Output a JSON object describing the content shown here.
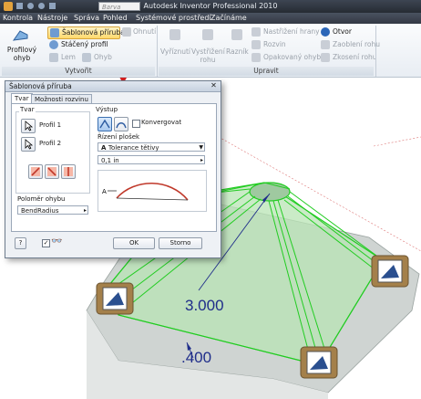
{
  "titlebar": {
    "app_title": "Autodesk Inventor Professional 2010",
    "search_placeholder": "Barva"
  },
  "menu": [
    {
      "label": "Kontrola"
    },
    {
      "label": "Nástroje"
    },
    {
      "label": "Správa"
    },
    {
      "label": "Pohled"
    },
    {
      "label": "Systémové prostředí"
    },
    {
      "label": "Začínáme"
    }
  ],
  "ribbon": {
    "create": {
      "contour_flange": "Profilový ohyb",
      "contour_flange_line1": "Profilový",
      "contour_flange_line2": "ohyb",
      "lofted_flange": "Šablonová příruba",
      "contour_roll": "Stáčený profil",
      "hem": "Lem",
      "fold": "Ohyb",
      "bend": "Ohnutí",
      "panel_label": "Vytvořit"
    },
    "modify": {
      "cut_line1": "Vyříznutí",
      "flange_cut_line1": "Vystřižení",
      "flange_cut_line2": "rohu",
      "punch": "Razník",
      "refold": "Nastřižení hrany",
      "unfold": "Rozvin",
      "rep_bend": "Opakovaný ohyb",
      "hole": "Otvor",
      "corner_round": "Zaoblení rohu",
      "corner_chamfer": "Zkosení rohu",
      "panel_label": "Upravit"
    }
  },
  "dialog": {
    "title": "Šablonová příruba",
    "close": "✕",
    "tabs": [
      {
        "label": "Tvar"
      },
      {
        "label": "Možnosti rozvinu"
      }
    ],
    "shape_group": "Tvar",
    "profile1": "Profil 1",
    "profile2": "Profil 2",
    "output_group": "Výstup",
    "converge_label": "Konvergovat",
    "facet_control_label": "Řízení plošek",
    "facet_control_value": "Tolerance tětivy",
    "facet_value": "0,1 in",
    "bend_radius_label": "Poloměr ohybu",
    "bend_radius_value": "BendRadius",
    "ok": "OK",
    "cancel": "Storno"
  },
  "viewport": {
    "dimension_1": "3.000",
    "dimension_2": ".400",
    "edge_color": "#22cc22",
    "dim_color": "#1f2d8a"
  }
}
